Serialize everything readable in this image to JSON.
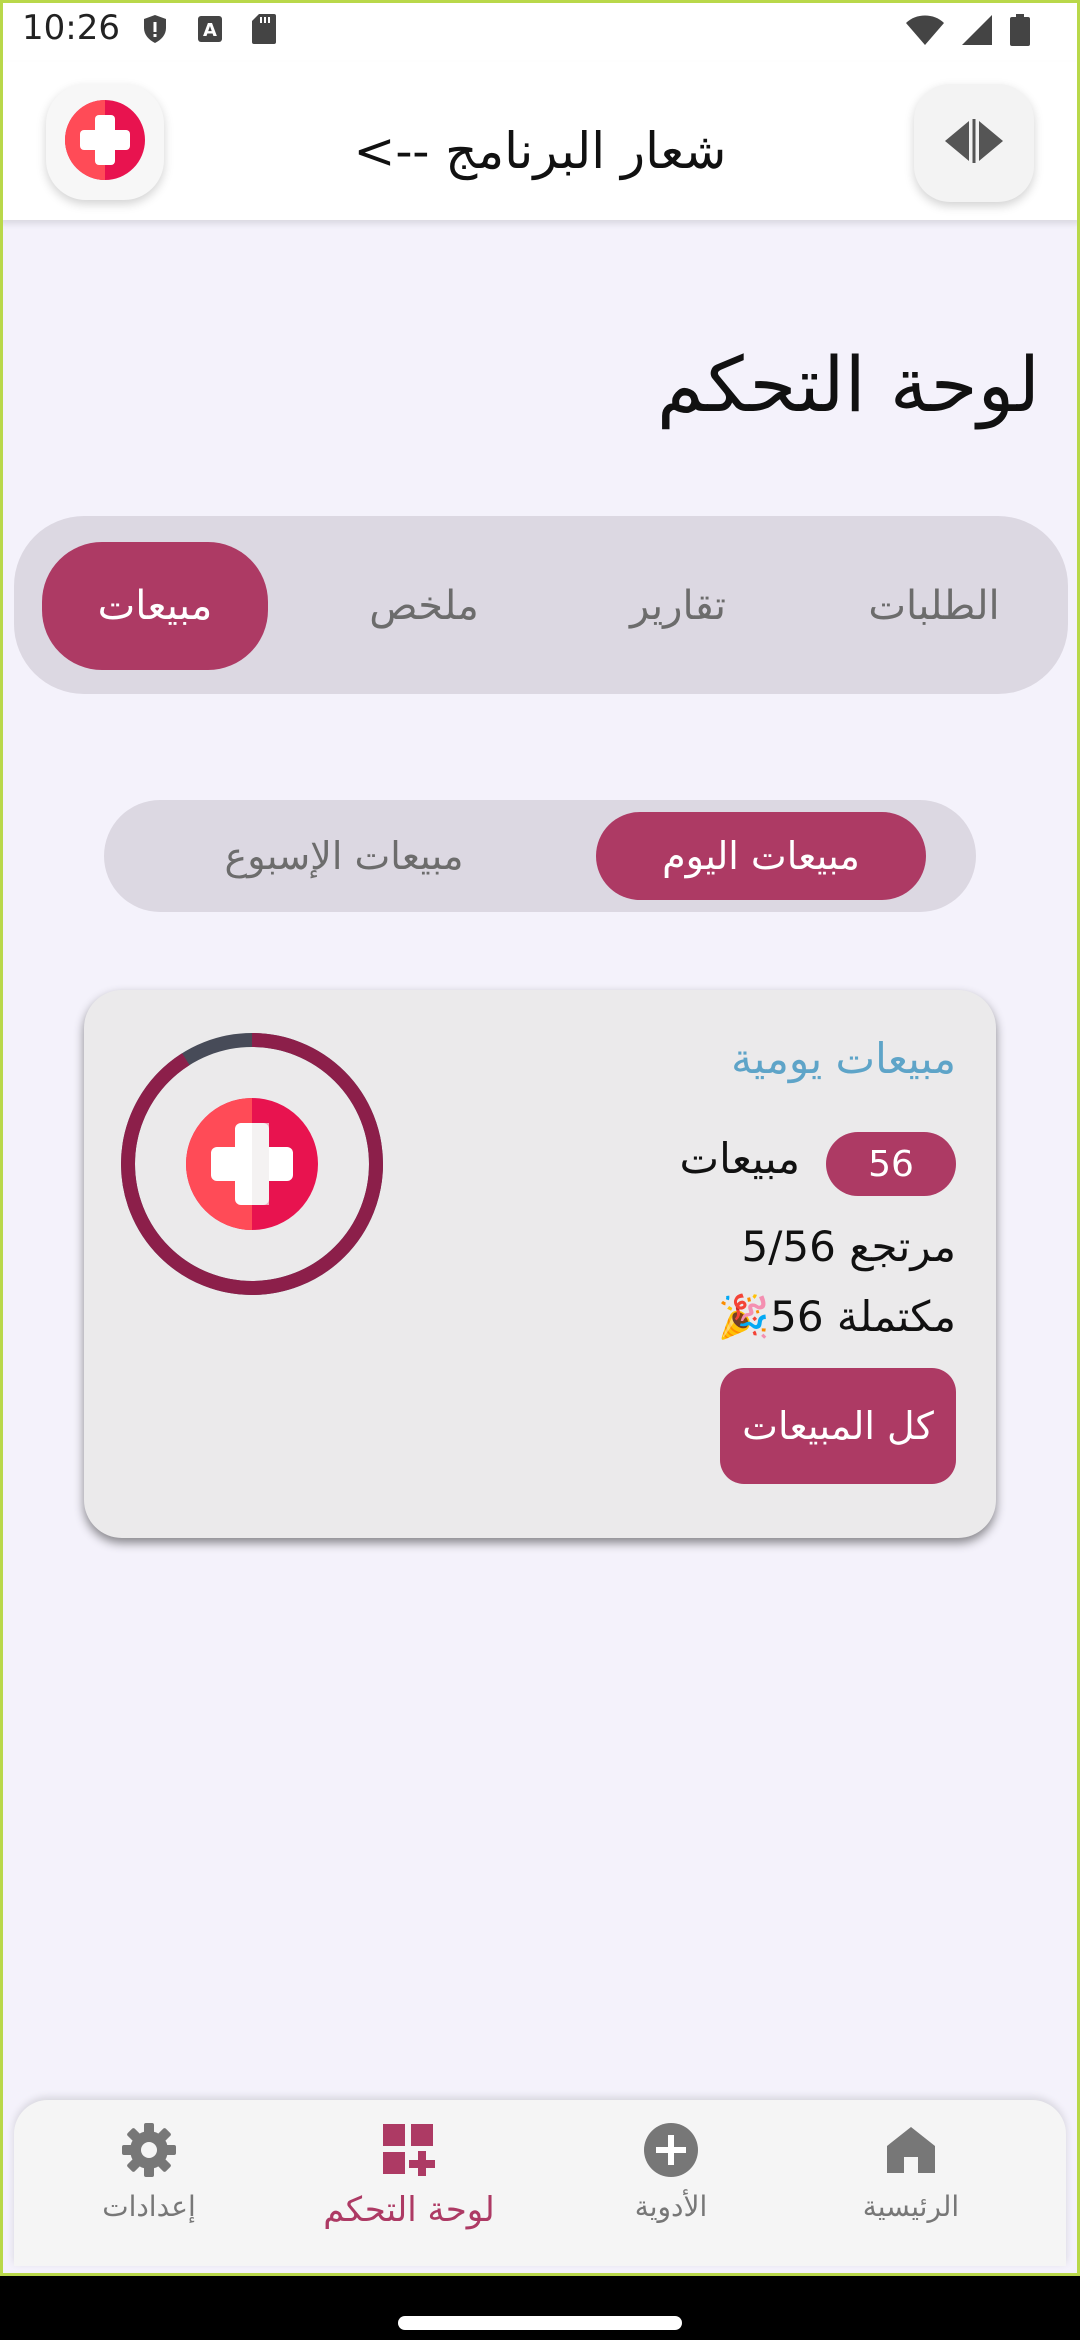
{
  "status_bar": {
    "time": "10:26",
    "icons_left": [
      "shield-icon",
      "font-a-icon",
      "sd-card-icon"
    ],
    "icons_right": [
      "wifi-icon",
      "signal-icon",
      "battery-icon"
    ]
  },
  "app_bar": {
    "title": "شعار البرنامج -->",
    "logo_icon": "medical-cross-logo",
    "toggle_icon": "code-toggle-icon"
  },
  "page_title": "لوحة التحكم",
  "main_tabs": [
    {
      "label": "الطلبات",
      "active": false
    },
    {
      "label": "تقارير",
      "active": false
    },
    {
      "label": "ملخص",
      "active": false
    },
    {
      "label": "مبيعات",
      "active": true
    }
  ],
  "sub_tabs": [
    {
      "label": "مبيعات اليوم",
      "active": true
    },
    {
      "label": "مبيعات الإسبوع",
      "active": false
    }
  ],
  "card": {
    "title": "مبيعات يومية",
    "sales_count": "56",
    "sales_label": "مبيعات",
    "returns_text": "مرتجع 5/56",
    "completed_text": "مكتملة 56",
    "celebrate_emoji": "🎉",
    "button_label": "كل المبيعات",
    "progress_fraction": 0.91
  },
  "bottom_nav": [
    {
      "label": "الرئيسية",
      "icon": "home-icon",
      "active": false
    },
    {
      "label": "الأدوية",
      "icon": "plus-circle-icon",
      "active": false
    },
    {
      "label": "لوحة التحكم",
      "icon": "dashboard-plus-icon",
      "active": true
    },
    {
      "label": "إعدادات",
      "icon": "gear-icon",
      "active": false
    }
  ],
  "colors": {
    "accent": "#ad3a64",
    "card_title": "#5ea4c8",
    "background": "#f4f2fb",
    "tab_track": "#dcd8e2"
  }
}
